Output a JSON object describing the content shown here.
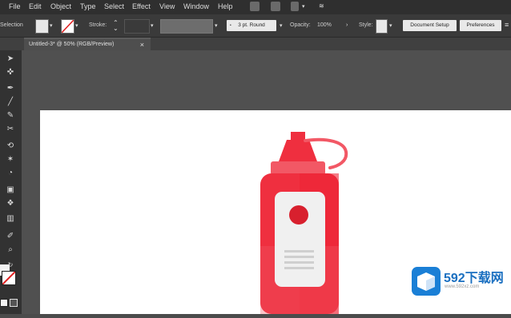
{
  "menu": {
    "items": [
      "File",
      "Edit",
      "Object",
      "Type",
      "Select",
      "Effect",
      "View",
      "Window",
      "Help"
    ]
  },
  "control_bar": {
    "selection_label": "Selection",
    "stroke_label": "Stroke:",
    "brush_value": "3 pt. Round",
    "opacity_label": "Opacity:",
    "opacity_value": "100%",
    "style_label": "Style:",
    "document_setup": "Document Setup",
    "preferences": "Preferences"
  },
  "document_tab": {
    "title": "Untitled-3* @ 50% (RGB/Preview)",
    "close": "×"
  },
  "tools": [
    "selection-tool",
    "direct-selection-tool",
    "pen-tool",
    "line-tool",
    "paintbrush-tool",
    "scissors-tool",
    "rotate-tool",
    "puppet-warp-tool",
    "shape-builder-tool",
    "gradient-tool",
    "symbol-sprayer-tool",
    "column-graph-tool",
    "eyedropper-tool",
    "zoom-tool"
  ],
  "watermark": {
    "brand": "592下载网",
    "url": "www.592xz.com"
  },
  "colors": {
    "bottle_red": "#ef2f3f",
    "bottle_light": "#f25865",
    "label_bg": "#f0f0f0",
    "dot": "#d8202e"
  }
}
